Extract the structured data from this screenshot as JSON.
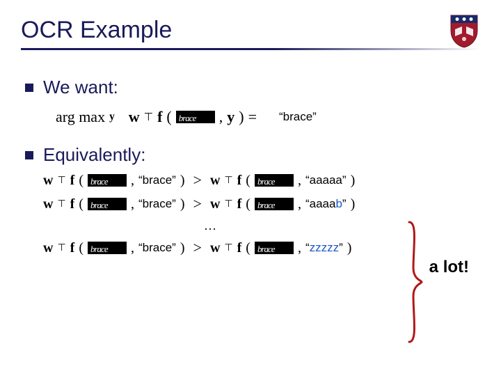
{
  "title": "OCR Example",
  "bullets": {
    "b1": "We want:",
    "b2": "Equivalently:"
  },
  "eq1": {
    "argmax": "arg max",
    "y": "y",
    "w": "w",
    "T": "⊤",
    "f": "f",
    "lparen": "(",
    "comma": ", ",
    "yvar": "y",
    "rparen": ")",
    "equals": " = ",
    "result_word": "“brace”"
  },
  "ineq": {
    "w": "w",
    "T": "⊤",
    "f": "f",
    "lparen": "(",
    "comma": ", ",
    "rparen": ")",
    "gt": ">",
    "lhs_word": "“brace”",
    "rhs_words": {
      "r1": "“aaaaa”",
      "r2_pre": "“aaaa",
      "r2_b": "b",
      "r2_post": "”",
      "r3_pre": "“",
      "r3_z": "zzzzz",
      "r3_post": "”"
    }
  },
  "dots": "…",
  "annotation": "a lot!",
  "handwriting": "brace"
}
